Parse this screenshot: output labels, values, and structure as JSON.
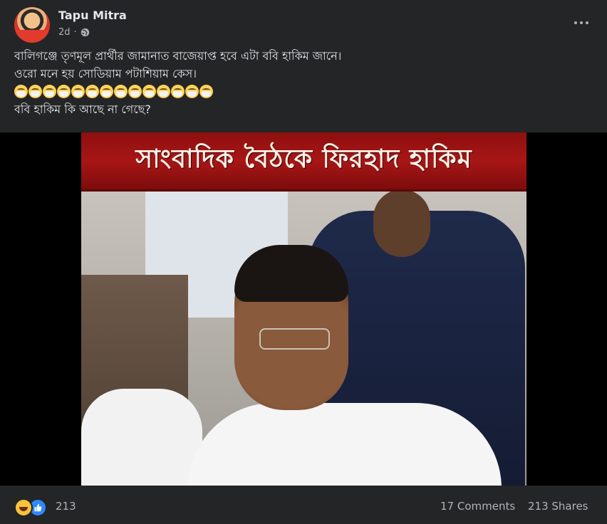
{
  "post": {
    "author": "Tapu Mitra",
    "time": "2d",
    "privacy_icon": "globe-icon",
    "lines": [
      "বালিগঞ্জে তৃণমূল প্রার্থীর জামানাত বাজেয়াপ্ত হবে এটা ববি হাকিম জানে।",
      "ওরো মনে হয় সোডিয়াম পটাশিয়াম কেস।"
    ],
    "emoji_name": "face-with-medical-mask-emoji",
    "emoji_count": 14,
    "last_line": "ববি হাকিম কি আছে না গেছে?"
  },
  "media": {
    "banner_text": "সাংবাদিক বৈঠকে ফিরহাদ হাকিম"
  },
  "footer": {
    "reactions": [
      "haha-icon",
      "like-icon"
    ],
    "reaction_count": "213",
    "comments": "17 Comments",
    "shares": "213 Shares"
  },
  "colors": {
    "background": "#242526",
    "text": "#e4e6eb",
    "secondary_text": "#b0b3b8",
    "like_blue": "#2d88ff",
    "banner_red": "#a81616"
  }
}
